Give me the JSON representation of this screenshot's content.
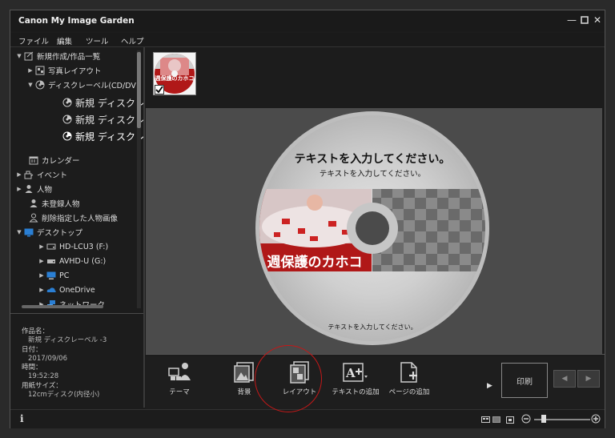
{
  "window": {
    "title": "Canon My Image Garden"
  },
  "menu": [
    "ファイル",
    "編集",
    "ツール",
    "ヘルプ"
  ],
  "tree": {
    "new_work_list": "新規作成/作品一覧",
    "photo_layout": "写真レイアウト",
    "disc_label": "ディスクレーベル(CD/DV",
    "new_disc_1": "新規 ディスクレー",
    "new_disc_2": "新規 ディスクレー",
    "new_disc_3": "新規 ディスクレー",
    "calendar": "カレンダー",
    "event": "イベント",
    "people": "人物",
    "unregistered": "未登録人物",
    "deleted_people": "削除指定した人物画像",
    "desktop": "デスクトップ",
    "hd_lcu3": "HD-LCU3 (F:)",
    "avhd": "AVHD-U (G:)",
    "pc": "PC",
    "onedrive": "OneDrive",
    "network": "ネットワーク"
  },
  "info": {
    "name_label": "作品名：",
    "name_value": "新規 ディスクレーベル -3",
    "date_label": "日付：",
    "date_value": "2017/09/06",
    "time_label": "時間：",
    "time_value": "19:52:28",
    "paper_label": "用紙サイズ：",
    "paper_value": "12cmディスク(内径小)"
  },
  "disc": {
    "title_text": "テキストを入力してください。",
    "subtitle_text": "テキストを入力してください。",
    "bottom_text": "テキストを入力してください。",
    "photo_text": "週保護のカホコ",
    "thumb_text": "週保護のカホコ"
  },
  "toolbar": {
    "theme": "テーマ",
    "background": "背景",
    "layout": "レイアウト",
    "add_text": "テキストの追加",
    "add_page": "ページの追加",
    "print": "印刷"
  },
  "colors": {
    "highlight": "#c41818",
    "disc_red": "#b01818"
  }
}
